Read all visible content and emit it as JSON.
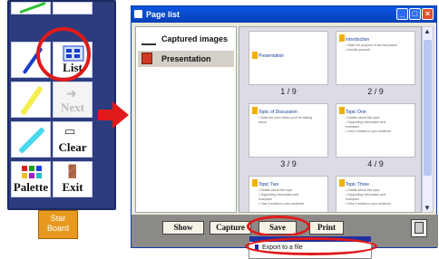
{
  "toolbar": {
    "list_label": "List",
    "next_label": "Next",
    "clear_label": "Clear",
    "palette_label": "Palette",
    "exit_label": "Exit",
    "starboard_label_1": "Star",
    "starboard_label_2": "Board"
  },
  "window": {
    "title": "Page list",
    "minimize": "_",
    "maximize": "□",
    "close": "×"
  },
  "sidebar": {
    "items": [
      {
        "label": "Captured images"
      },
      {
        "label": "Presentation"
      }
    ]
  },
  "thumbnails": [
    {
      "title": "Presentation",
      "lines": "",
      "page": "1 / 9"
    },
    {
      "title": "Introduction",
      "lines": "• State the purpose of the discussion\n• Identify yourself",
      "page": "2 / 9"
    },
    {
      "title": "Topic of Discussion",
      "lines": "• State the main ideas you'll be talking about",
      "page": "3 / 9"
    },
    {
      "title": "Topic One",
      "lines": "• Details about this topic\n• Supporting information and examples\n• How it relates to your audience",
      "page": "4 / 9"
    },
    {
      "title": "Topic Two",
      "lines": "• Details about this topic\n• Supporting information and examples\n• How it relates to your audience",
      "page": ""
    },
    {
      "title": "Topic Three",
      "lines": "• Details about this topic\n• Supporting information and examples\n• How it relates to your audience",
      "page": ""
    }
  ],
  "buttons": {
    "show": "Show",
    "capture": "Capture",
    "save": "Save",
    "print": "Print"
  },
  "menu": {
    "item_export": "Export to a file"
  },
  "colors": {
    "accent_red": "#e01a1a",
    "title_blue": "#0a56e0"
  }
}
